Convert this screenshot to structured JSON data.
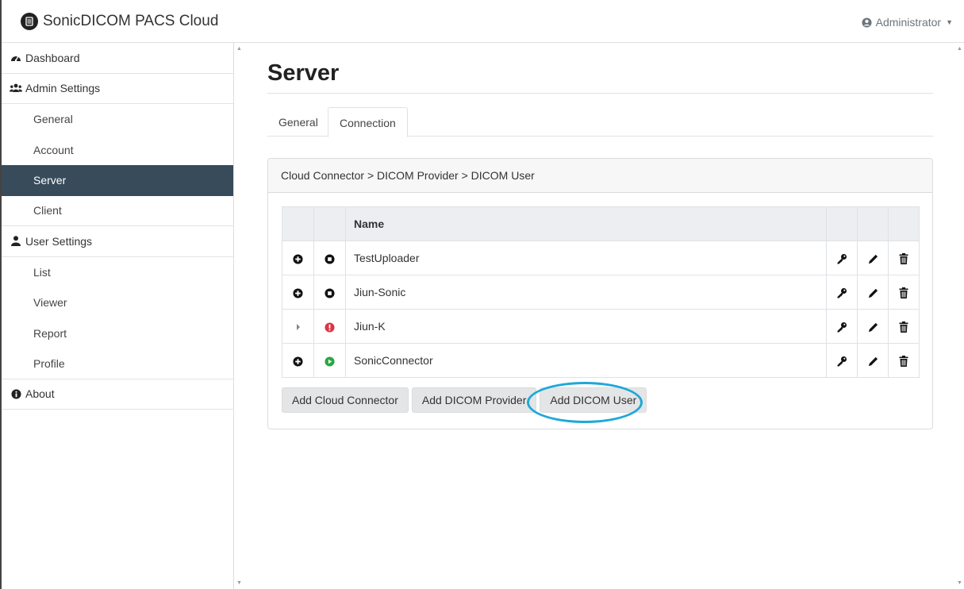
{
  "header": {
    "app_title": "SonicDICOM PACS Cloud",
    "user_label": "Administrator",
    "logo_icon": "server-logo-icon",
    "user_icon": "user-circle-icon"
  },
  "sidebar": {
    "dashboard": "Dashboard",
    "admin_settings": "Admin Settings",
    "admin_items": [
      "General",
      "Account",
      "Server",
      "Client"
    ],
    "user_settings": "User Settings",
    "user_items": [
      "List",
      "Viewer",
      "Report",
      "Profile"
    ],
    "about": "About",
    "active_item": "Server",
    "active_color": "#384b5b"
  },
  "main": {
    "title": "Server",
    "tabs": [
      "General",
      "Connection"
    ],
    "active_tab": "Connection",
    "breadcrumb": "Cloud Connector > DICOM Provider > DICOM User",
    "table": {
      "header_name": "Name",
      "rows": [
        {
          "name": "TestUploader",
          "expand_icon": "plus-circle-icon",
          "status_icon": "stop-circle-icon"
        },
        {
          "name": "Jiun-Sonic",
          "expand_icon": "plus-circle-icon",
          "status_icon": "stop-circle-icon"
        },
        {
          "name": "Jiun-K",
          "expand_icon": "caret-right-icon",
          "status_icon": "error-circle-icon"
        },
        {
          "name": "SonicConnector",
          "expand_icon": "plus-circle-icon",
          "status_icon": "play-circle-icon"
        }
      ],
      "row_actions": [
        "key-icon",
        "pencil-icon",
        "trash-icon"
      ]
    },
    "buttons": {
      "add_cloud_connector": "Add Cloud Connector",
      "add_dicom_provider": "Add DICOM Provider",
      "add_dicom_user": "Add DICOM User"
    },
    "colors": {
      "error": "#dc3545",
      "running": "#28a745",
      "highlight": "#1fa8d8"
    }
  }
}
